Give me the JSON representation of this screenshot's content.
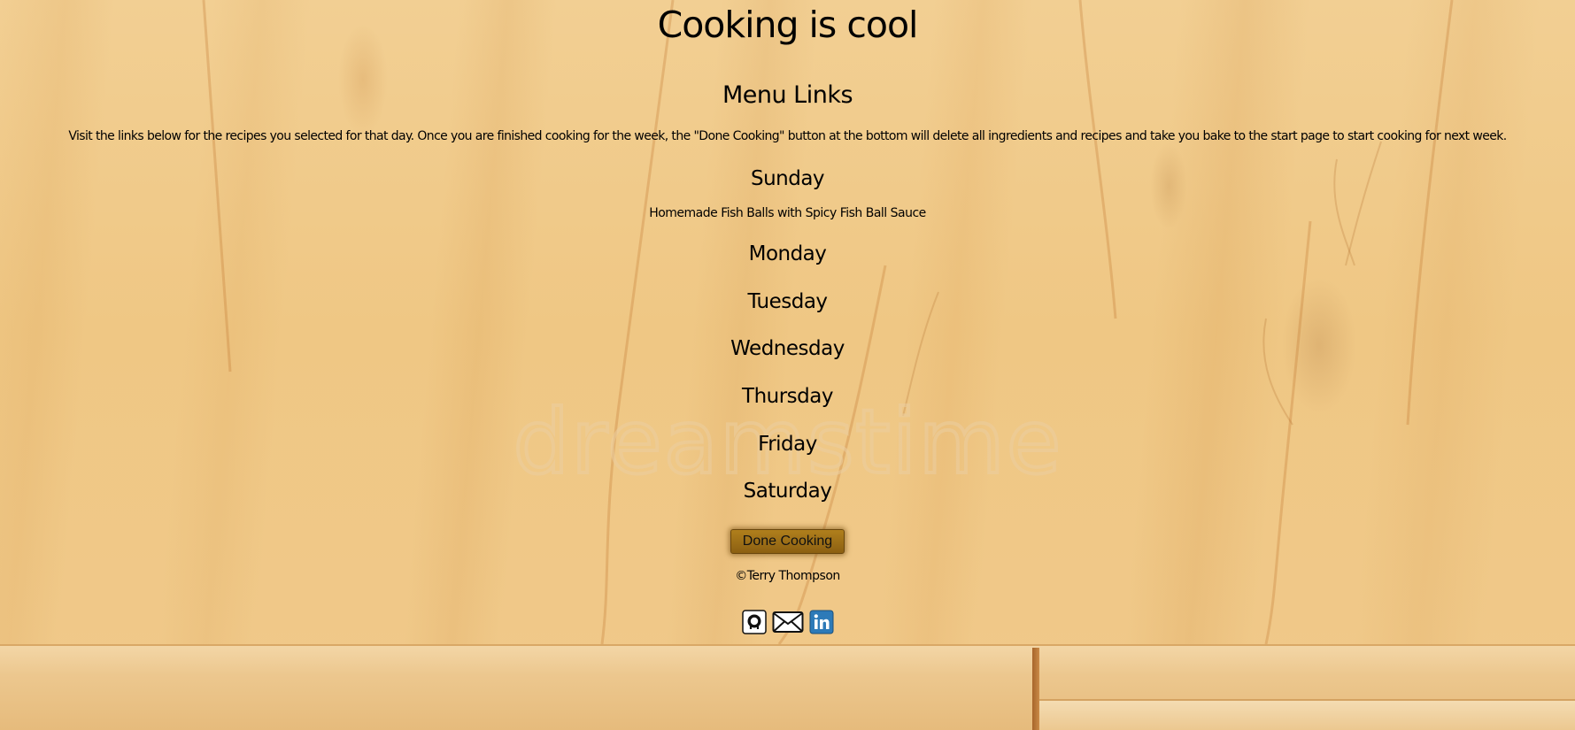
{
  "page": {
    "title": "Cooking is cool",
    "subtitle": "Menu Links",
    "intro": "Visit the links below for the recipes you selected for that day. Once you are finished cooking for the week, the \"Done Cooking\" button at the bottom will delete all ingredients and recipes and take you bake to the start page to start cooking for next week."
  },
  "days": [
    {
      "label": "Sunday",
      "recipe": "Homemade Fish Balls with Spicy Fish Ball Sauce"
    },
    {
      "label": "Monday"
    },
    {
      "label": "Tuesday"
    },
    {
      "label": "Wednesday"
    },
    {
      "label": "Thursday"
    },
    {
      "label": "Friday"
    },
    {
      "label": "Saturday"
    }
  ],
  "done_button": {
    "label": "Done Cooking",
    "color": "#9c6d16"
  },
  "footer": {
    "copyright": "©Terry Thompson",
    "social_icons": [
      "github-icon",
      "mail-icon",
      "linkedin-icon"
    ]
  },
  "background": {
    "watermark": "dreamstime",
    "wood_color": "#f0c98a"
  }
}
